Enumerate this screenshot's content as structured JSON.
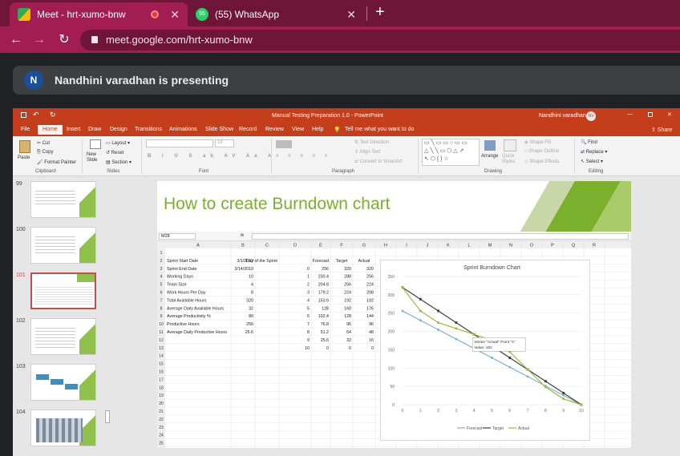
{
  "browser": {
    "tabs": [
      {
        "title": "Meet - hrt-xumo-bnw",
        "active": true
      },
      {
        "title": "(55) WhatsApp",
        "active": false,
        "badge": "55"
      }
    ],
    "new_tab": "+",
    "url": "meet.google.com/hrt-xumo-bnw"
  },
  "meet": {
    "avatar_initial": "N",
    "presenting_text": "Nandhini varadhan is presenting"
  },
  "ppt": {
    "window_title": "Manual Testing Preparation 1.0  -  PowerPoint",
    "user_name": "Nandhini varadhan",
    "user_initials": "NV",
    "menu": [
      "File",
      "Home",
      "Insert",
      "Draw",
      "Design",
      "Transitions",
      "Animations",
      "Slide Show",
      "Record",
      "Review",
      "View",
      "Help",
      "Tell me what you want to do"
    ],
    "share": "Share",
    "ribbon": {
      "paste": "Paste",
      "cut": "Cut",
      "copy": "Copy",
      "format_painter": "Format Painter",
      "clipboard": "Clipboard",
      "new_slide": "New Slide",
      "layout": "Layout",
      "reset": "Reset",
      "section": "Section",
      "slides": "Slides",
      "font": "Font",
      "paragraph": "Paragraph",
      "text_direction": "Text Direction",
      "align_text": "Align Text",
      "convert_smartart": "Convert to SmartArt",
      "arrange": "Arrange",
      "quick_styles": "Quick Styles",
      "shape_fill": "Shape Fill",
      "shape_outline": "Shape Outline",
      "shape_effects": "Shape Effects",
      "drawing": "Drawing",
      "find": "Find",
      "replace": "Replace",
      "select": "Select",
      "editing": "Editing",
      "font_size": "18"
    },
    "slide_numbers": [
      "99",
      "100",
      "101",
      "102",
      "103",
      "104"
    ],
    "slide_title": "How to create Burndown chart",
    "excel": {
      "name_box": "M28",
      "fx": "fx",
      "columns": [
        "A",
        "B",
        "C",
        "D",
        "E",
        "F",
        "G",
        "H",
        "I",
        "J",
        "K",
        "L",
        "M",
        "N",
        "O",
        "P",
        "Q",
        "R"
      ],
      "rows": [
        "1",
        "2",
        "3",
        "4",
        "5",
        "6",
        "7",
        "8",
        "9",
        "10",
        "11",
        "12",
        "13",
        "14",
        "15",
        "16",
        "17",
        "18",
        "19",
        "20",
        "21",
        "22",
        "23",
        "24",
        "25"
      ],
      "labels": [
        [
          "Sprint Start Date",
          "3/1/2019"
        ],
        [
          "Sprint End Date",
          "3/14/2019"
        ],
        [
          "Working Days",
          "10"
        ],
        [
          "Team Size",
          "4"
        ],
        [
          "Work Hours Per Day",
          "8"
        ],
        [
          "Total Available Hours",
          "320"
        ],
        [
          "Average Daily Available Hours",
          "32"
        ],
        [
          "Average Productivity %",
          "80"
        ],
        [
          "Productive Hours",
          "256"
        ],
        [
          "Average Daily Productive Hours",
          "25.6"
        ]
      ],
      "table_header": [
        "Day of the Sprint",
        "Forecast",
        "Target",
        "Actual"
      ],
      "table_rows": [
        [
          "0",
          "256",
          "320",
          "320"
        ],
        [
          "1",
          "230.4",
          "288",
          "256"
        ],
        [
          "2",
          "204.8",
          "256",
          "224"
        ],
        [
          "3",
          "179.2",
          "224",
          "208"
        ],
        [
          "4",
          "153.6",
          "192",
          "192"
        ],
        [
          "5",
          "128",
          "160",
          "176"
        ],
        [
          "6",
          "102.4",
          "128",
          "144"
        ],
        [
          "7",
          "76.8",
          "96",
          "96"
        ],
        [
          "8",
          "51.2",
          "64",
          "48"
        ],
        [
          "9",
          "25.6",
          "32",
          "16"
        ],
        [
          "10",
          "0",
          "0",
          "0"
        ]
      ]
    }
  },
  "chart_data": {
    "type": "line",
    "title": "Sprint Burndown Chart",
    "x": [
      0,
      1,
      2,
      3,
      4,
      5,
      6,
      7,
      8,
      9,
      10
    ],
    "ylim": [
      0,
      350
    ],
    "yticks": [
      0,
      50,
      100,
      150,
      200,
      250,
      300,
      350
    ],
    "series": [
      {
        "name": "Forecast",
        "color": "#7fb2d9",
        "values": [
          256,
          230.4,
          204.8,
          179.2,
          153.6,
          128,
          102.4,
          76.8,
          51.2,
          25.6,
          0
        ]
      },
      {
        "name": "Target",
        "color": "#404040",
        "values": [
          320,
          288,
          256,
          224,
          192,
          160,
          128,
          96,
          64,
          32,
          0
        ]
      },
      {
        "name": "Actual",
        "color": "#9bbb3c",
        "values": [
          320,
          256,
          224,
          208,
          192,
          176,
          144,
          96,
          48,
          16,
          0
        ]
      }
    ],
    "tooltip": {
      "line1": "Series \"Actual\" Point \"4\"",
      "line2": "Value: 192"
    },
    "legend_position": "bottom"
  }
}
